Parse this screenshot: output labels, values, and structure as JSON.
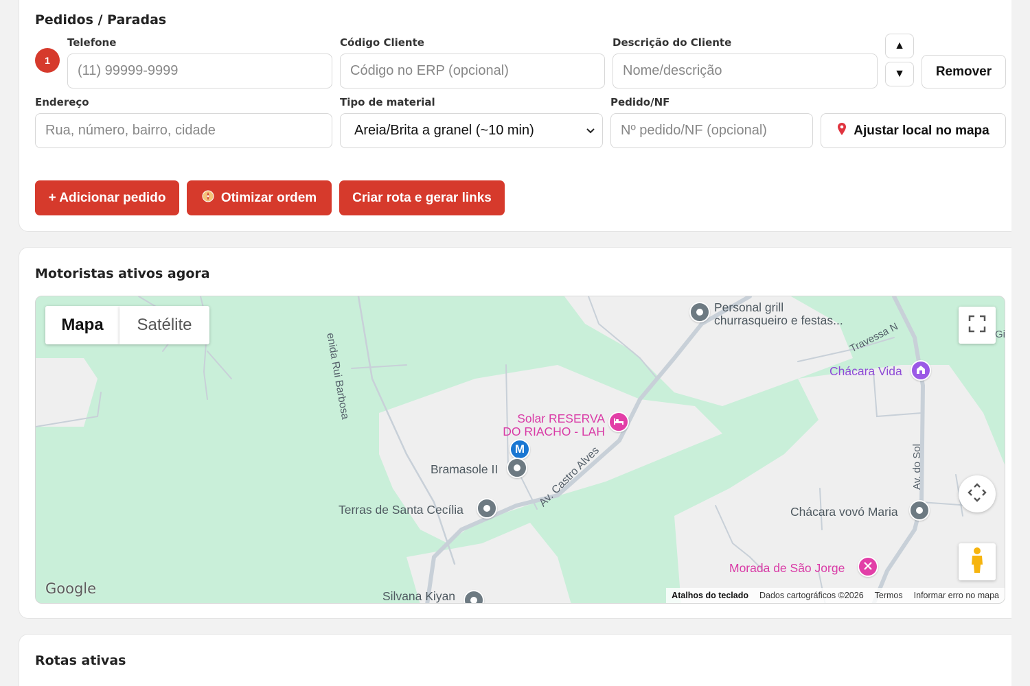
{
  "orders": {
    "title": "Pedidos / Paradas",
    "stop_number": "1",
    "fields": {
      "phone_label": "Telefone",
      "phone_placeholder": "(11) 99999-9999",
      "client_code_label": "Código Cliente",
      "client_code_placeholder": "Código no ERP (opcional)",
      "client_desc_label": "Descrição do Cliente",
      "client_desc_placeholder": "Nome/descrição",
      "address_label": "Endereço",
      "address_placeholder": "Rua, número, bairro, cidade",
      "material_label": "Tipo de material",
      "material_value": "Areia/Brita a granel (~10 min)",
      "order_label": "Pedido/NF",
      "order_placeholder": "Nº pedido/NF (opcional)"
    },
    "move_up": "▲",
    "move_down": "▼",
    "remove_label": "Remover",
    "adjust_map_label": "Ajustar local no mapa",
    "add_order_label": "+ Adicionar pedido",
    "optimize_label": "Otimizar ordem",
    "create_route_label": "Criar rota e gerar links"
  },
  "drivers": {
    "title": "Motoristas ativos agora",
    "map": {
      "type_map": "Mapa",
      "type_satellite": "Satélite",
      "driver_marker": "M",
      "pois": {
        "personal_grill_1": "Personal grill",
        "personal_grill_2": "churrasqueiro e festas...",
        "chacara_vida": "Chácara Vida",
        "solar_1": "Solar RESERVA",
        "solar_2": "DO RIACHO - LAH",
        "bramasole": "Bramasole II",
        "terras": "Terras de Santa Cecília",
        "chacara_vovo": "Chácara vovó Maria",
        "morada": "Morada de São Jorge",
        "silvana": "Silvana Kiyan"
      },
      "roads": {
        "rui_barbosa": "enida Rui Barbosa",
        "castro_alves": "Av. Castro Alves",
        "travessa": "Travessa N",
        "do_sol": "Av. do Sol",
        "cut_label": "Gi"
      },
      "google_logo": "Google",
      "attribution": {
        "shortcuts": "Atalhos do teclado",
        "map_data": "Dados cartográficos ©2026",
        "terms": "Termos",
        "report": "Informar erro no mapa"
      },
      "colors": {
        "park": "#c9efd9",
        "land": "#efefef",
        "road": "#c8d0d8"
      }
    }
  },
  "routes": {
    "title": "Rotas ativas"
  },
  "colors": {
    "accent": "#d63a2c"
  }
}
